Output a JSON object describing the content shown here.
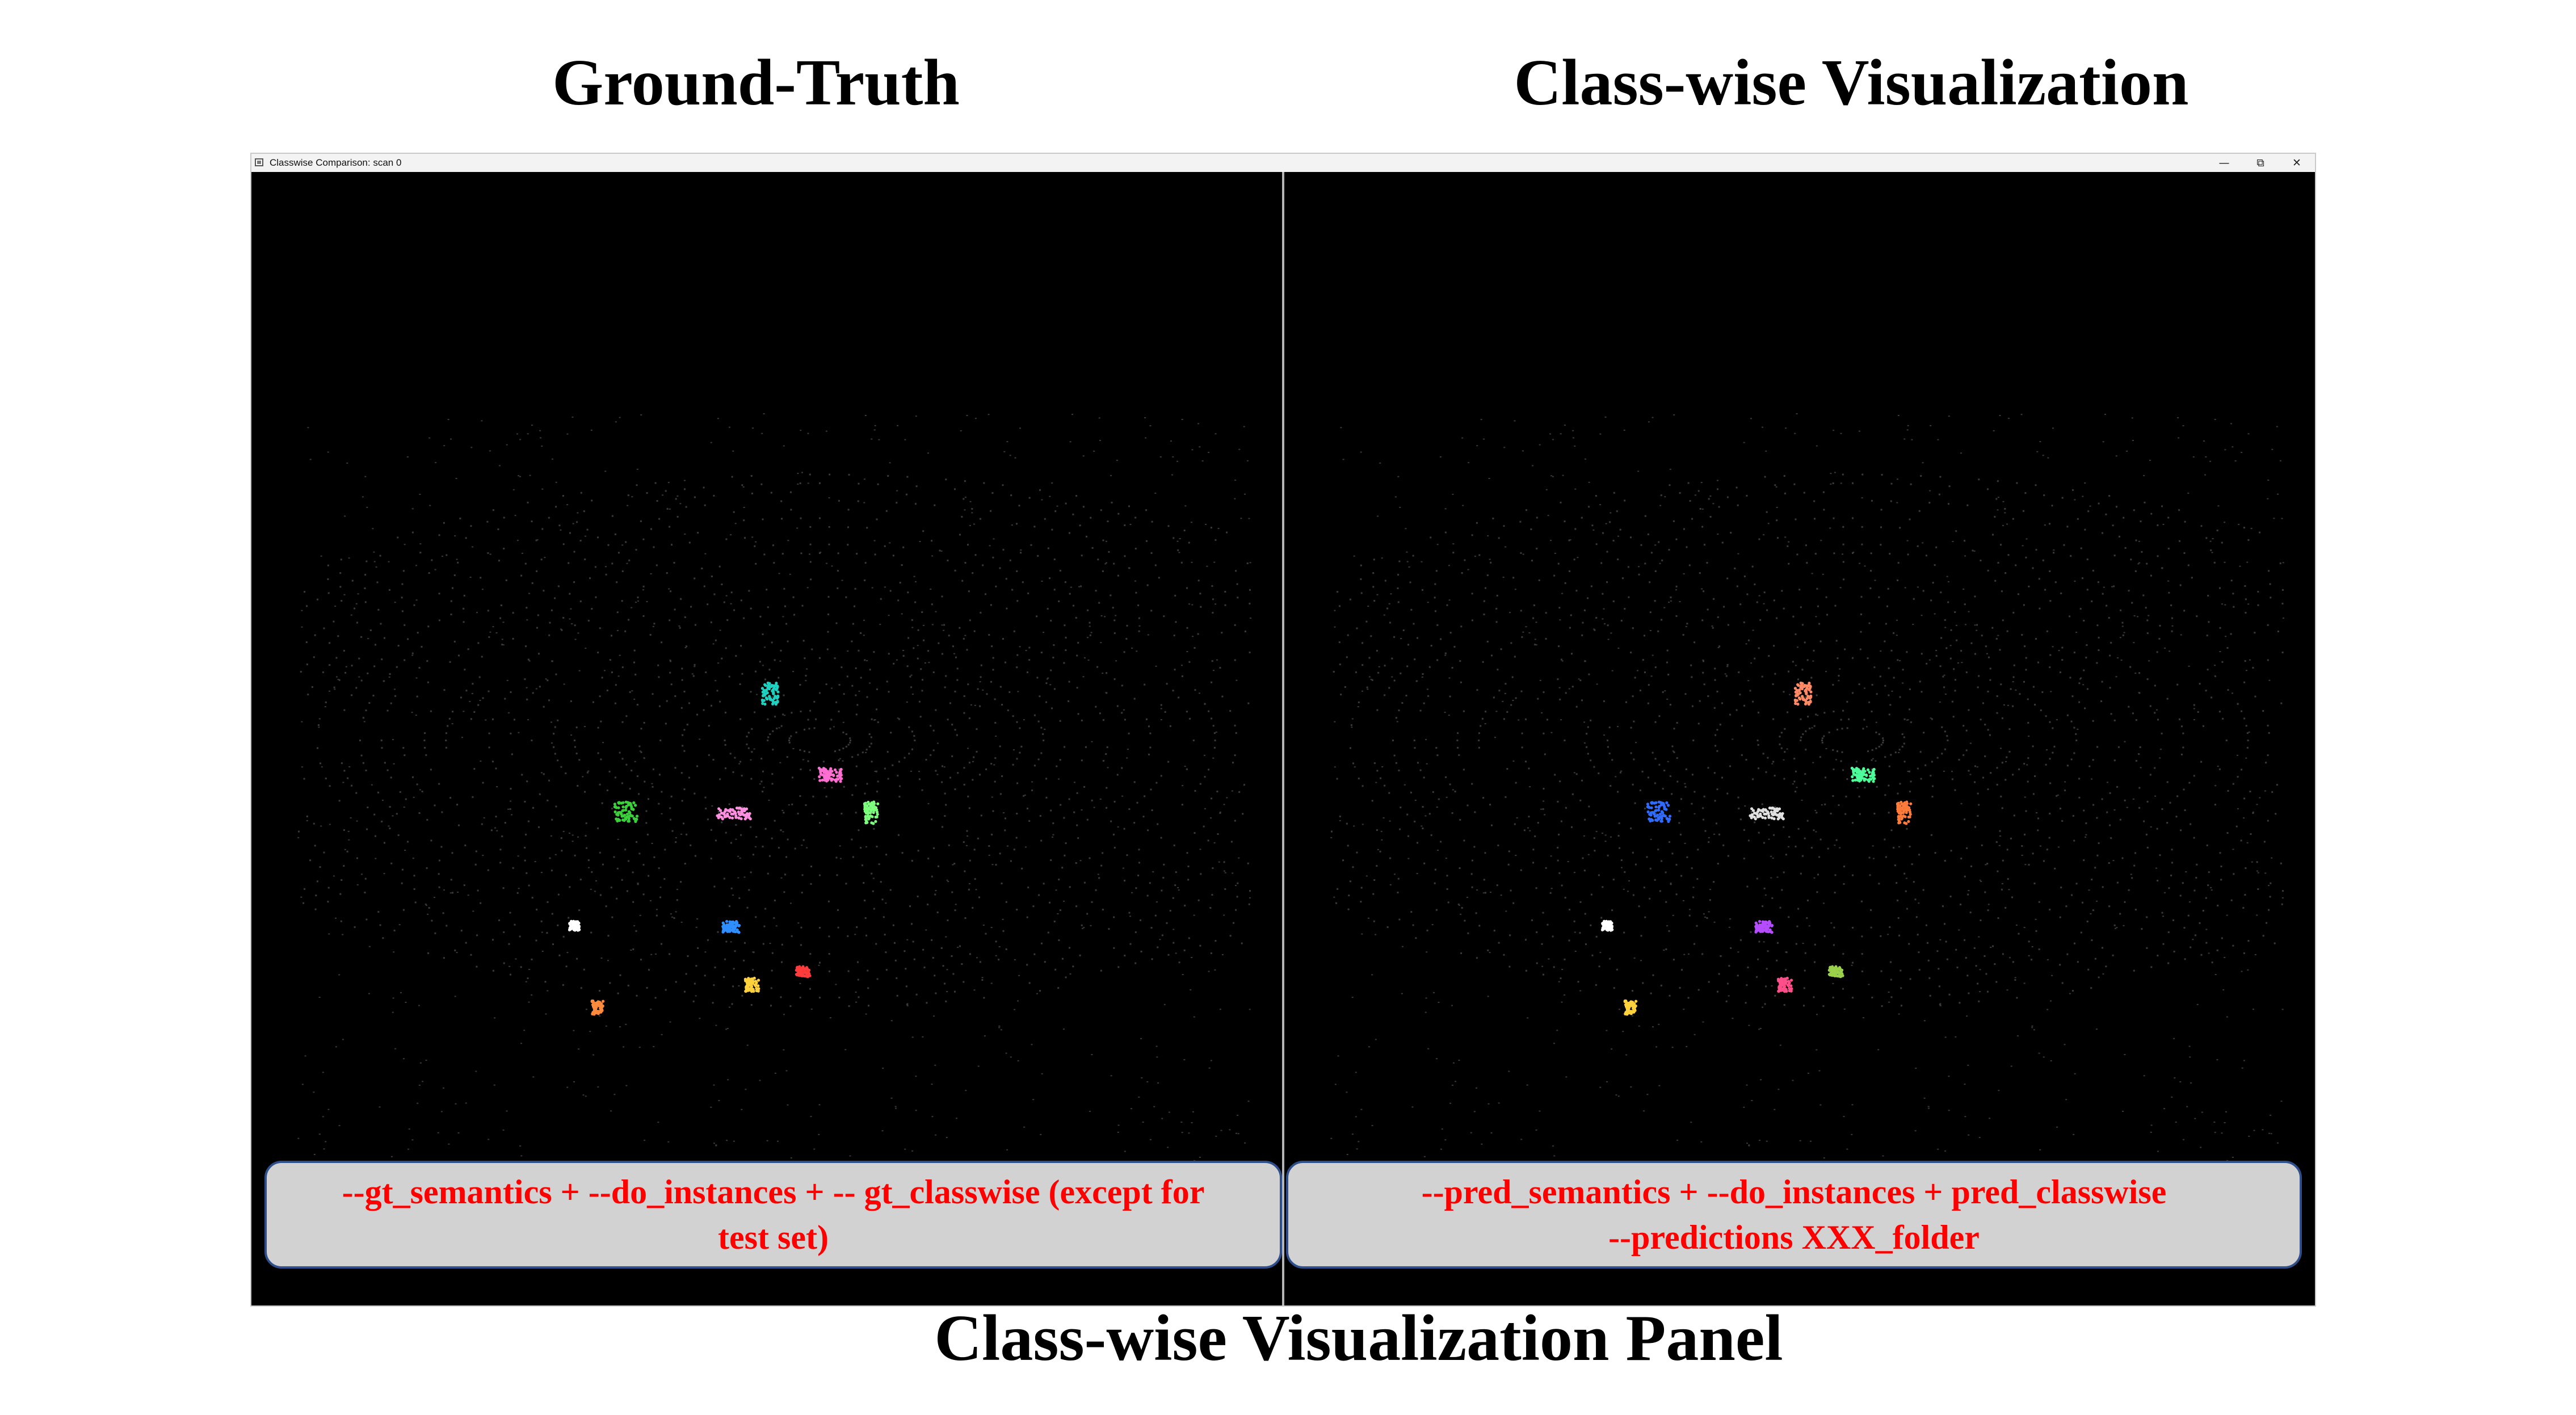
{
  "figure": {
    "left_heading": "Ground-Truth",
    "right_heading": "Class-wise Visualization",
    "caption": "Class-wise Visualization Panel"
  },
  "window": {
    "title": "Classwise Comparison: scan 0",
    "icons": {
      "app": "app-window-icon",
      "minimize": "minimize-icon",
      "restore": "restore-icon",
      "close": "close-icon"
    },
    "controls": {
      "minimize": "—",
      "restore": "⧉",
      "close": "✕"
    }
  },
  "views": {
    "left": {
      "name": "ground-truth-scan",
      "command_lines": [
        "--gt_semantics + --do_instances + -- gt_classwise (except for",
        "test set)"
      ]
    },
    "right": {
      "name": "classwise-scan",
      "command_lines": [
        "--pred_semantics + --do_instances + pred_classwise",
        "--predictions XXX_folder"
      ]
    }
  },
  "colors": {
    "background": "#000000",
    "point_gray": "#3a3a3a",
    "command_text": "#ff0000",
    "command_box": "#d2d2d2",
    "command_border": "#2f4f8c",
    "gt_instances": [
      "#1fd1c1",
      "#ff6fd2",
      "#ff8fe0",
      "#7dff7d",
      "#3ad13a",
      "#ff8a3d",
      "#2f8fff",
      "#ffd23d",
      "#ff3b3b",
      "#ffffff"
    ],
    "pred_instances": [
      "#ff8a65",
      "#4dff9a",
      "#e0e0e0",
      "#ff7b3a",
      "#2f6bff",
      "#ffd23d",
      "#b54dff",
      "#ff4f8a",
      "#9ad14a",
      "#ffffff"
    ]
  }
}
